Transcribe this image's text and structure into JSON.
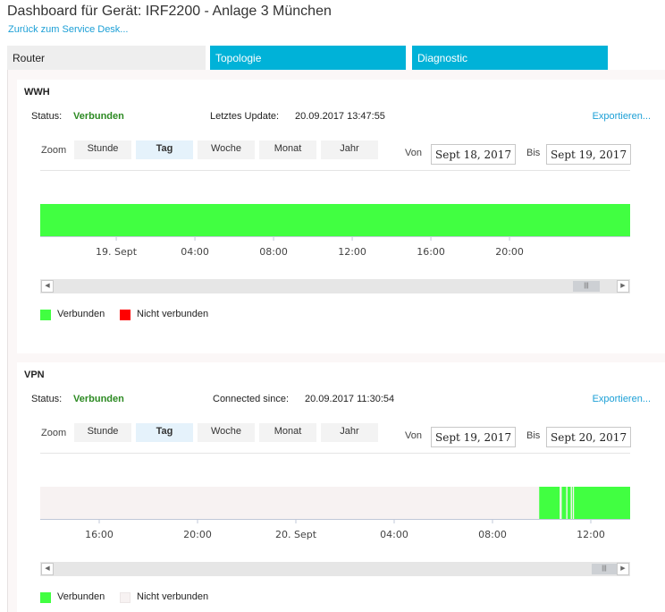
{
  "page": {
    "title": "Dashboard für Gerät: IRF2200 - Anlage 3 München",
    "back_link": "Zurück zum Service Desk..."
  },
  "tabs": [
    {
      "label": "Router",
      "selected": true
    },
    {
      "label": "Topologie",
      "selected": false
    },
    {
      "label": "Diagnostic",
      "selected": false
    }
  ],
  "colors": {
    "tab_accent": "#00b2d8",
    "connected": "#41ff41",
    "not_connected_wwh": "#ff0000",
    "not_connected_vpn": "#f7f2f2",
    "status_ok": "#2c8a22",
    "link": "#1b9fd6"
  },
  "panels": [
    {
      "title": "WWH",
      "status_label": "Status:",
      "status_value": "Verbunden",
      "info_label": "Letztes Update:",
      "info_value": "20.09.2017 13:47:55",
      "export_label": "Exportieren...",
      "zoom_label": "Zoom",
      "zoom_options": [
        "Stunde",
        "Tag",
        "Woche",
        "Monat",
        "Jahr"
      ],
      "zoom_selected": "Tag",
      "from_label": "Von",
      "from_value": "Sept 18, 2017",
      "to_label": "Bis",
      "to_value": "Sept 19, 2017",
      "scroll_thumb_icon": "grip-icon",
      "legend": [
        {
          "label": "Verbunden",
          "color": "#41ff41"
        },
        {
          "label": "Nicht verbunden",
          "color": "#ff0000"
        }
      ],
      "chart_data": {
        "type": "area",
        "x_range": [
          "18.09.2017 16:08",
          "19.09.2017 22:08"
        ],
        "tick_labels": [
          "19. Sept",
          "04:00",
          "08:00",
          "12:00",
          "16:00",
          "20:00"
        ],
        "segments": [
          {
            "start": "18.09.2017 16:08",
            "end": "19.09.2017 22:08",
            "state": "Verbunden"
          }
        ],
        "background_color": "#f7f2f2"
      }
    },
    {
      "title": "VPN",
      "status_label": "Status:",
      "status_value": "Verbunden",
      "info_label": "Connected since:",
      "info_value": "20.09.2017 11:30:54",
      "export_label": "Exportieren...",
      "zoom_label": "Zoom",
      "zoom_options": [
        "Stunde",
        "Tag",
        "Woche",
        "Monat",
        "Jahr"
      ],
      "zoom_selected": "Tag",
      "from_label": "Von",
      "from_value": "Sept 19, 2017",
      "to_label": "Bis",
      "to_value": "Sept 20, 2017",
      "scroll_thumb_icon": "grip-icon",
      "legend": [
        {
          "label": "Verbunden",
          "color": "#41ff41"
        },
        {
          "label": "Nicht verbunden",
          "color": "#f7f2f2"
        }
      ],
      "chart_data": {
        "type": "area",
        "x_range": [
          "19.09.2017 13:36",
          "20.09.2017 13:36"
        ],
        "tick_labels": [
          "16:00",
          "20:00",
          "20. Sept",
          "04:00",
          "08:00",
          "12:00"
        ],
        "segments": [
          {
            "start": "20.09.2017 09:54",
            "end": "20.09.2017 10:44",
            "state": "Verbunden"
          },
          {
            "start": "20.09.2017 10:49",
            "end": "20.09.2017 11:00",
            "state": "Verbunden"
          },
          {
            "start": "20.09.2017 11:03",
            "end": "20.09.2017 11:11",
            "state": "Verbunden"
          },
          {
            "start": "20.09.2017 11:14",
            "end": "20.09.2017 11:16",
            "state": "Verbunden"
          },
          {
            "start": "20.09.2017 11:19",
            "end": "20.09.2017 13:36",
            "state": "Verbunden"
          }
        ],
        "background_color": "#f7f2f2"
      }
    }
  ]
}
